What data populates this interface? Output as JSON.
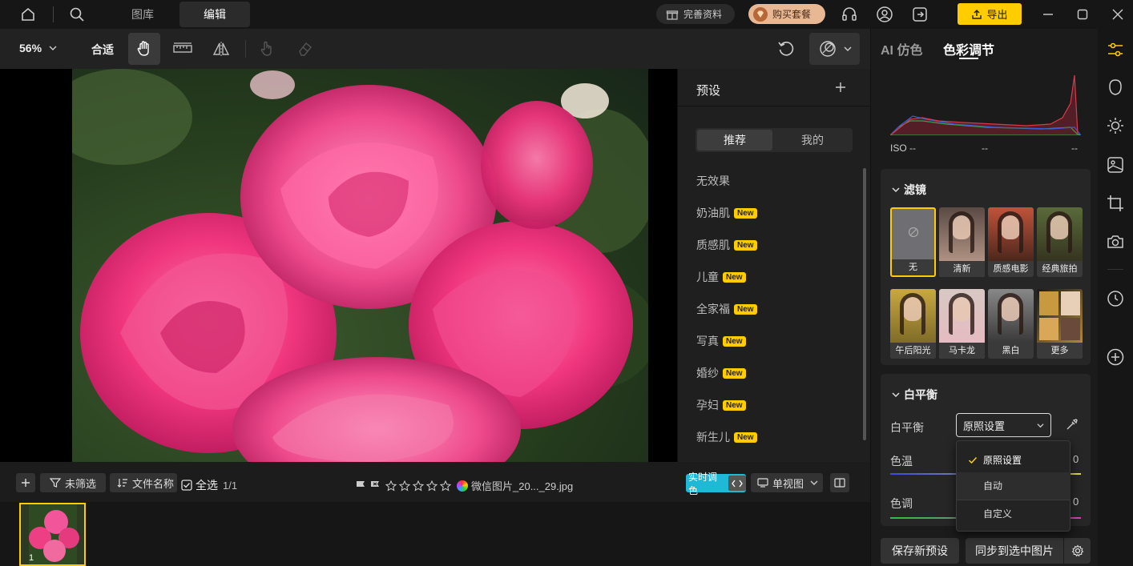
{
  "titlebar": {
    "tab_library": "图库",
    "tab_edit": "编辑",
    "complete_info": "完善资料",
    "buy_package": "购买套餐",
    "export": "导出"
  },
  "toolbar": {
    "zoom": "56%",
    "fit": "合适"
  },
  "presets": {
    "title": "预设",
    "tab_recommended": "推荐",
    "tab_mine": "我的",
    "new_badge": "New",
    "items": [
      {
        "label": "无效果",
        "new": false
      },
      {
        "label": "奶油肌",
        "new": true
      },
      {
        "label": "质感肌",
        "new": true
      },
      {
        "label": "儿童",
        "new": true
      },
      {
        "label": "全家福",
        "new": true
      },
      {
        "label": "写真",
        "new": true
      },
      {
        "label": "婚纱",
        "new": true
      },
      {
        "label": "孕妇",
        "new": true
      },
      {
        "label": "新生儿",
        "new": true
      }
    ]
  },
  "stripbar": {
    "unfiltered": "未筛选",
    "filename": "文件名称",
    "select_all": "全选",
    "count": "1/1",
    "file_label": "微信图片_20..._29.jpg",
    "realtime": "实时调色",
    "single_view": "单视图",
    "thumb_index": "1"
  },
  "rightpanel": {
    "tab_ai": "AI 仿色",
    "tab_color": "色彩调节",
    "iso": "ISO --",
    "dash1": "--",
    "dash2": "--",
    "filter_title": "滤镜",
    "filters": [
      "无",
      "清新",
      "质感电影",
      "经典旅拍",
      "午后阳光",
      "马卡龙",
      "黑白",
      "更多"
    ],
    "wb_title": "白平衡",
    "wb_label": "白平衡",
    "wb_value": "原照设置",
    "temp_label": "色温",
    "tint_label": "色调",
    "temp_value": "0",
    "tint_value": "0",
    "dropdown": [
      "原照设置",
      "自动",
      "自定义"
    ],
    "save_preset": "保存新预设",
    "sync": "同步到选中图片"
  },
  "colors": {
    "accent": "#ffcc00",
    "cyan": "#1fb8d6",
    "rose": "#ff3d8b"
  }
}
